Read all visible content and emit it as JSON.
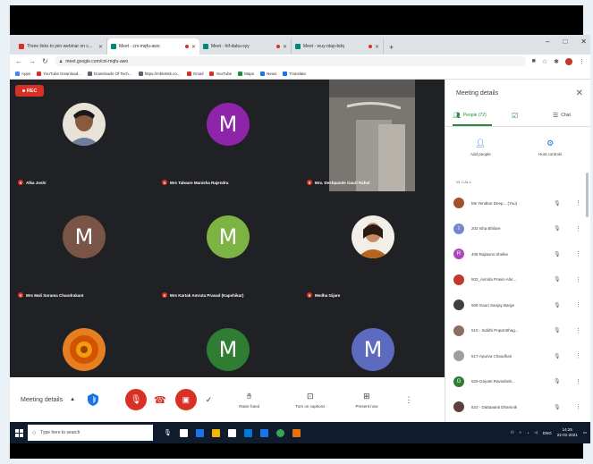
{
  "browser": {
    "tabs": [
      {
        "title": "Three links to join webinar on c...",
        "active": false,
        "recording": false,
        "color": "#d93025"
      },
      {
        "title": "Meet - cni-mqfu-awo",
        "active": true,
        "recording": true,
        "color": "#00897b"
      },
      {
        "title": "Meet - hif-dabu-syy",
        "active": false,
        "recording": true,
        "color": "#00897b"
      },
      {
        "title": "Meet - wuy-otap-bdq",
        "active": false,
        "recording": true,
        "color": "#00897b"
      }
    ],
    "new_tab": "+",
    "url": "meet.google.com/cni-mqfu-awo",
    "bookmarks": [
      {
        "label": "Apps",
        "color": "#4285f4"
      },
      {
        "label": "YouTube Download...",
        "color": "#d93025"
      },
      {
        "label": "Downloads Of Tech...",
        "color": "#5f6368"
      },
      {
        "label": "https://mbletstk.co...",
        "color": "#5f6368"
      },
      {
        "label": "Gmail",
        "color": "#d93025"
      },
      {
        "label": "YouTube",
        "color": "#d93025"
      },
      {
        "label": "Maps",
        "color": "#1e8e3e"
      },
      {
        "label": "News",
        "color": "#1a73e8"
      },
      {
        "label": "Translate",
        "color": "#1a73e8"
      }
    ]
  },
  "meet": {
    "rec_label": "REC",
    "tiles": [
      {
        "name": "Alka Joshi",
        "type": "photo",
        "initial": ""
      },
      {
        "name": "Mrs Talware Manisha Rajendra",
        "type": "letter",
        "initial": "M",
        "color": "#8e24aa"
      },
      {
        "name": "Mrs. Deshpande Gauri Rahul",
        "type": "camera",
        "initial": ""
      },
      {
        "name": "Mrs Mali Sorama Chandrakant",
        "type": "letter",
        "initial": "M",
        "color": "#795548"
      },
      {
        "name": "Mrs Kartak Amruta Prasad (Kapshikar)",
        "type": "letter",
        "initial": "M",
        "color": "#7cb342"
      },
      {
        "name": "Medha Gijare",
        "type": "photo",
        "initial": ""
      },
      {
        "name": "",
        "type": "flower",
        "initial": ""
      },
      {
        "name": "",
        "type": "letter",
        "initial": "M",
        "color": "#2e7d32"
      },
      {
        "name": "",
        "type": "letter",
        "initial": "M",
        "color": "#5c6bc0"
      }
    ],
    "controls": {
      "meeting_details": "Meeting details",
      "raise_hand": "Raise hand",
      "captions": "Turn on captions",
      "present": "Present now"
    }
  },
  "panel": {
    "title": "Meeting details",
    "people_tab": "People (72)",
    "chat_tab": "Chat",
    "add_people": "Add people",
    "host_controls": "Host controls",
    "in_call": "IN CALL",
    "participants": [
      {
        "name": "Ms Yendkar Deep... (You)",
        "type": "photo",
        "color": "#a0522d",
        "initial": ""
      },
      {
        "name": "203 Isha Bhilare",
        "type": "letter",
        "color": "#7986cb",
        "initial": "I"
      },
      {
        "name": "408 Rajlaxmi Shelke",
        "type": "letter",
        "color": "#ab47bc",
        "initial": "R"
      },
      {
        "name": "503_Asmita Pravin Ahir...",
        "type": "photo",
        "color": "#c0392b",
        "initial": ""
      },
      {
        "name": "509 Gauri Sanjay Barge",
        "type": "photo",
        "color": "#3c4043",
        "initial": ""
      },
      {
        "name": "510 - Siddhi Popat Bhag...",
        "type": "photo",
        "color": "#8d6e63",
        "initial": ""
      },
      {
        "name": "517-Apurva Chaudhari",
        "type": "photo",
        "color": "#9e9e9e",
        "initial": ""
      },
      {
        "name": "520-Gayatri Ravsaheb...",
        "type": "letter",
        "color": "#2e7d32",
        "initial": "G"
      },
      {
        "name": "523 - Dattaaanti Dhamnik",
        "type": "photo",
        "color": "#5d4037",
        "initial": ""
      }
    ]
  },
  "taskbar": {
    "search_placeholder": "Type here to search",
    "language": "ENG",
    "time": "14:25",
    "date": "22-01-2021"
  }
}
